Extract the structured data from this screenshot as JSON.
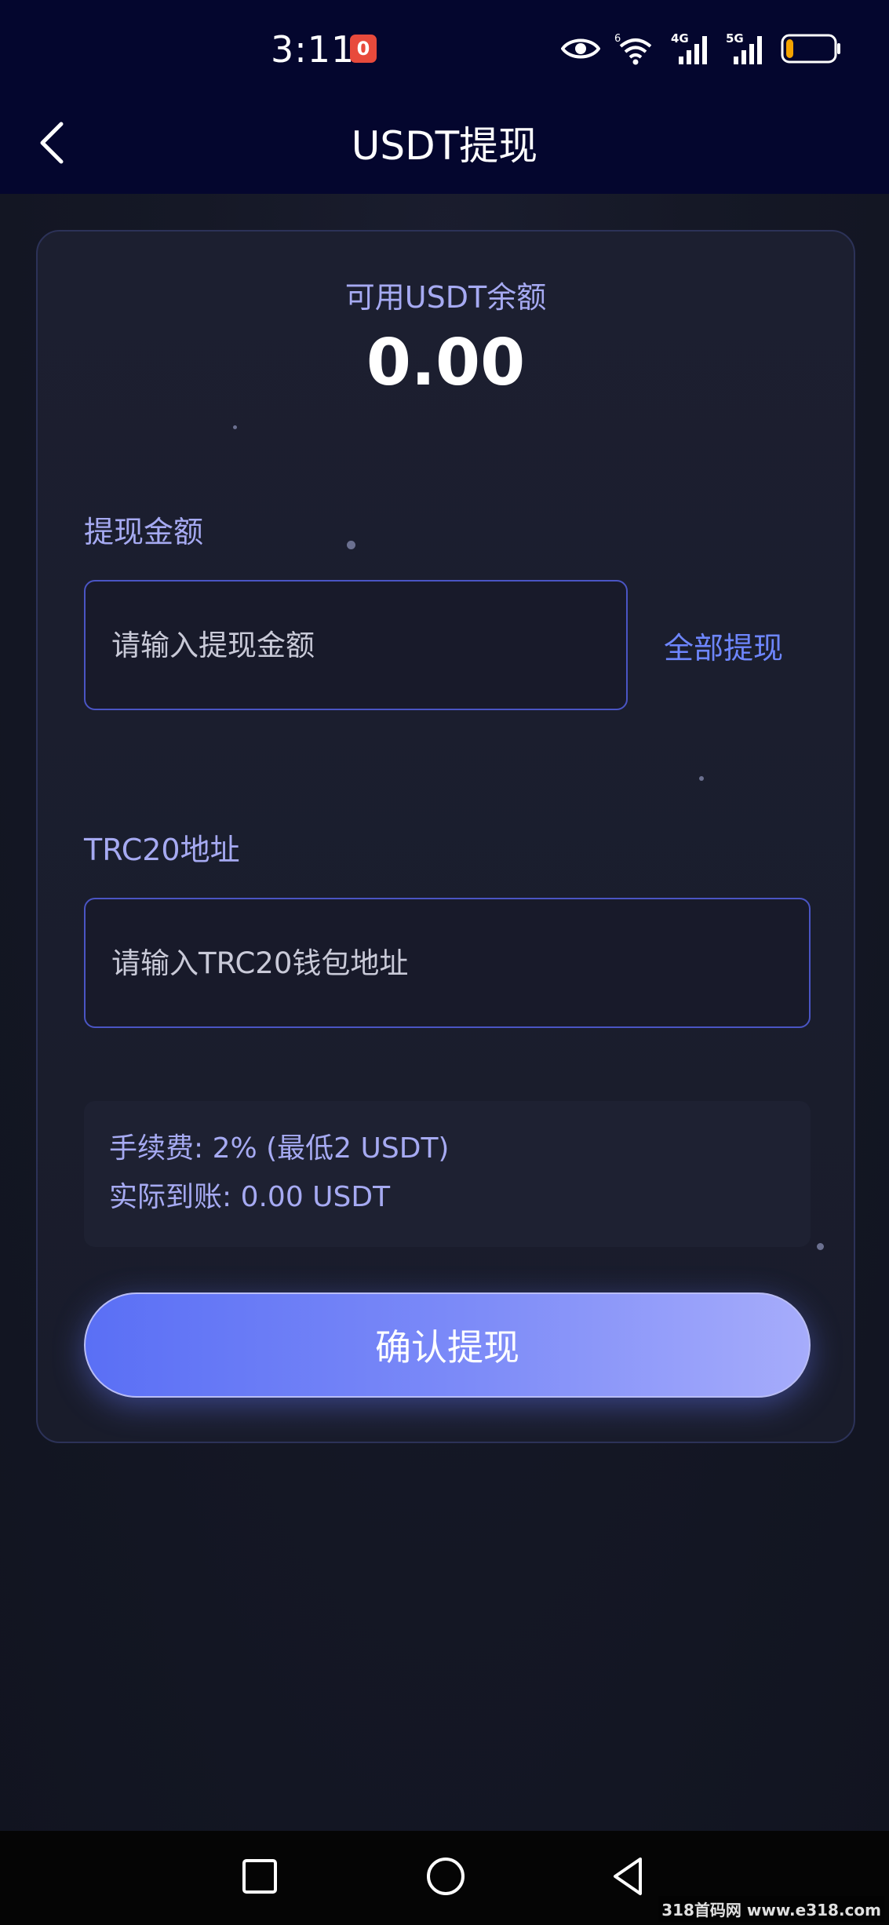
{
  "status_bar": {
    "time": "3:11",
    "notification_badge": "0",
    "network_labels": [
      "6",
      "4G",
      "5G"
    ],
    "battery_level": 0.15,
    "battery_color": "#f4a300"
  },
  "header": {
    "title": "USDT提现",
    "back_icon": "chevron-left-icon"
  },
  "balance": {
    "label": "可用USDT余额",
    "value": "0.00"
  },
  "amount_field": {
    "label": "提现金额",
    "placeholder": "请输入提现金额",
    "value": "",
    "withdraw_all_label": "全部提现"
  },
  "address_field": {
    "label": "TRC20地址",
    "placeholder": "请输入TRC20钱包地址",
    "value": ""
  },
  "fee_info": {
    "fee_line": "手续费: 2% (最低2 USDT)",
    "received_line": "实际到账: 0.00 USDT"
  },
  "confirm_button": {
    "label": "确认提现"
  },
  "nav_bar": {
    "icons": [
      "square-recents-icon",
      "circle-home-icon",
      "triangle-back-icon"
    ]
  },
  "watermark": "318首码网 www.e318.com",
  "colors": {
    "header_bg": "#04062e",
    "accent": "#6e86ff",
    "label": "#a6aaf2",
    "button_gradient_start": "#5a6ff5",
    "button_gradient_end": "#a6acfb"
  }
}
